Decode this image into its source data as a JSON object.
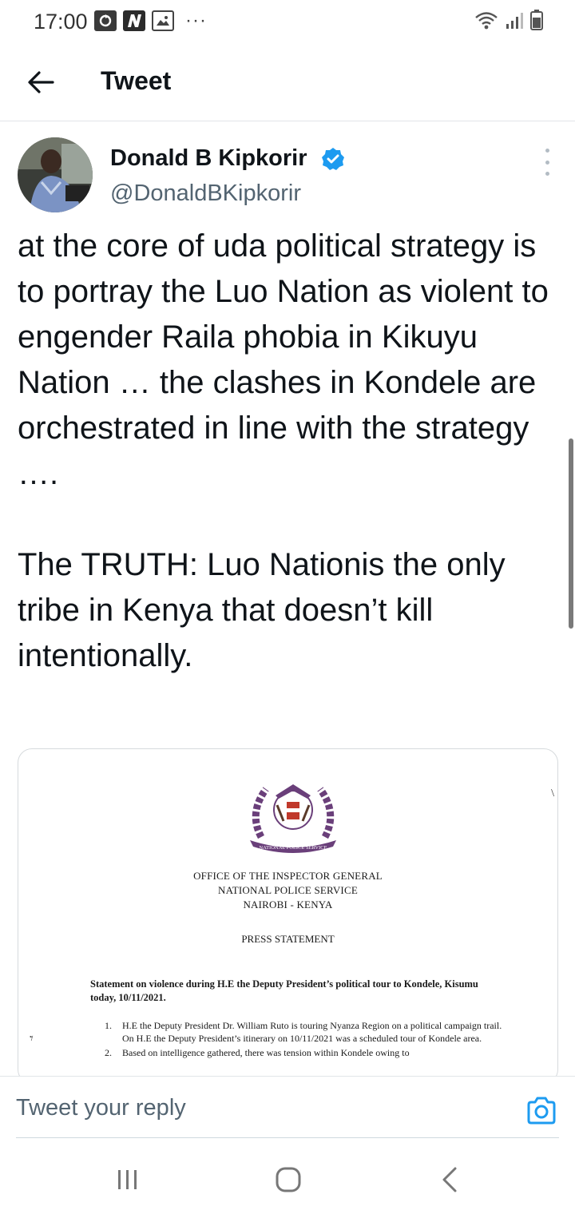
{
  "status_bar": {
    "time": "17:00",
    "left_icons": [
      "sync-icon",
      "n-app-icon",
      "gallery-icon"
    ],
    "more_indicator": "···",
    "right_icons": [
      "wifi-icon",
      "signal-icon",
      "battery-icon"
    ]
  },
  "header": {
    "back_icon": "arrow-left-icon",
    "title": "Tweet"
  },
  "tweet": {
    "author_name": "Donald B Kipkorir",
    "verified": true,
    "handle": "@DonaldBKipkorir",
    "text": "at the core of uda political strategy is to portray the Luo Nation as violent to engender Raila phobia in Kikuyu Nation … the clashes in Kondele are orchestrated in line with the strategy ….\n\nThe TRUTH: Luo Nationis the only tribe in Kenya that doesn’t kill intentionally."
  },
  "media": {
    "emblem_text": "NATIONAL POLICE SERVICE",
    "office_lines": [
      "OFFICE OF THE INSPECTOR GENERAL",
      "NATIONAL POLICE SERVICE",
      "NAIROBI - KENYA"
    ],
    "press_heading": "PRESS STATEMENT",
    "statement_title": "Statement on violence during H.E the Deputy President’s political tour to Kondele, Kisumu today, 10/11/2021.",
    "items": [
      {
        "num": "1.",
        "text": "H.E the Deputy President Dr. William Ruto is touring Nyanza Region on a political campaign trail. On H.E the Deputy President’s itinerary on 10/11/2021 was a scheduled tour of Kondele area."
      },
      {
        "num": "2.",
        "text": "Based on intelligence gathered, there was tension within Kondele owing to"
      }
    ]
  },
  "reply": {
    "placeholder": "Tweet your reply",
    "camera_icon": "camera-icon"
  },
  "nav": {
    "icons": [
      "recent-apps-icon",
      "home-icon",
      "back-nav-icon"
    ]
  },
  "colors": {
    "accent": "#1d9bf0",
    "text_primary": "#0f1419",
    "text_secondary": "#536471",
    "emblem": "#6a3f7a"
  }
}
